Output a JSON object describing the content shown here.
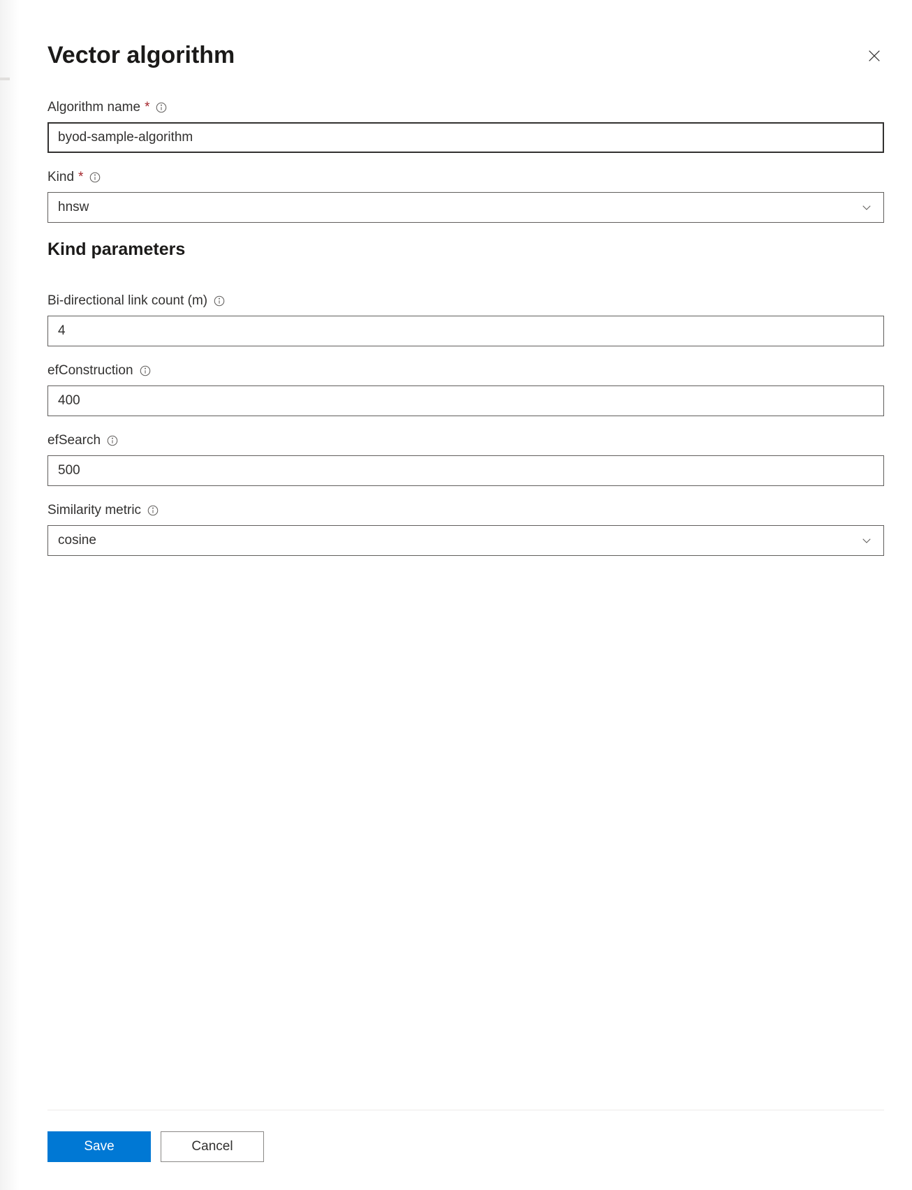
{
  "header": {
    "title": "Vector algorithm"
  },
  "fields": {
    "algorithmName": {
      "label": "Algorithm name",
      "value": "byod-sample-algorithm",
      "required": true
    },
    "kind": {
      "label": "Kind",
      "value": "hnsw",
      "required": true
    }
  },
  "section": {
    "heading": "Kind parameters"
  },
  "params": {
    "biDirectional": {
      "label": "Bi-directional link count (m)",
      "value": "4"
    },
    "efConstruction": {
      "label": "efConstruction",
      "value": "400"
    },
    "efSearch": {
      "label": "efSearch",
      "value": "500"
    },
    "similarityMetric": {
      "label": "Similarity metric",
      "value": "cosine"
    }
  },
  "footer": {
    "save": "Save",
    "cancel": "Cancel"
  }
}
